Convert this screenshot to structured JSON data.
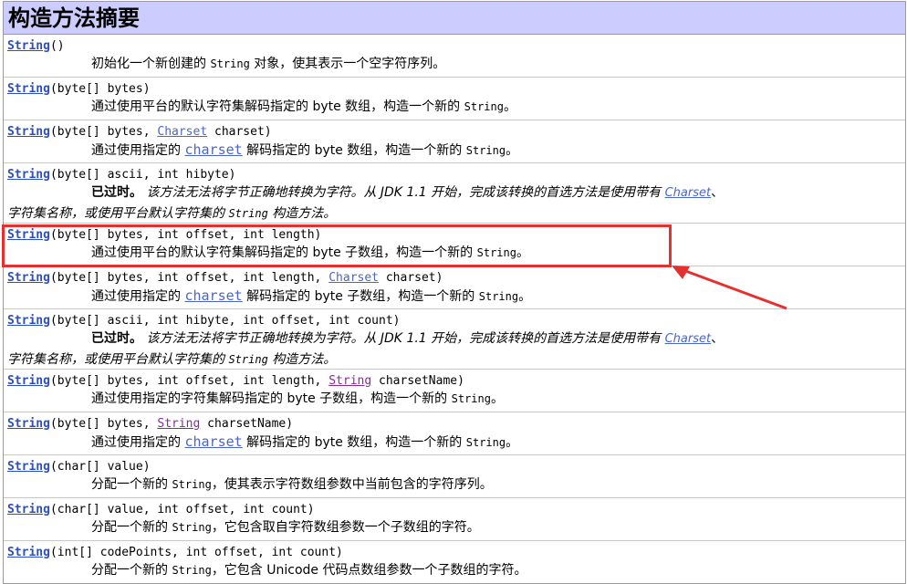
{
  "title": "构造方法摘要",
  "rows": [
    {
      "name": "String",
      "params": "()",
      "desc_pre": "初始化一个新创建的 ",
      "desc_code": "String",
      "desc_post": " 对象，使其表示一个空字符序列。"
    },
    {
      "name": "String",
      "params": "(byte[] bytes)",
      "desc_pre": "通过使用平台的默认字符集解码指定的 byte 数组，构造一个新的 ",
      "desc_code": "String",
      "desc_post": "。"
    },
    {
      "name": "String",
      "p1": "(byte[] bytes, ",
      "type": "Charset",
      "p2": " charset)",
      "d1": "通过使用指定的 ",
      "dl": "charset",
      "d2": " 解码指定的 byte 数组，构造一个新的 ",
      "dc": "String",
      "d3": "。"
    },
    {
      "name": "String",
      "params": "(byte[] ascii, int hibyte)",
      "dep": "已过时。",
      "l1": " 该方法无法将字节正确地转换为字符。从 JDK 1.1 开始，完成该转换的首选方法是使用带有 ",
      "lnk": "Charset",
      "l1b": "、",
      "l2": "字符集名称，或使用平台默认字符集的 ",
      "lc": "String",
      "l2b": " 构造方法。"
    },
    {
      "name": "String",
      "params": "(byte[] bytes, int offset, int length)",
      "desc_pre": "通过使用平台的默认字符集解码指定的 byte 子数组，构造一个新的 ",
      "desc_code": "String",
      "desc_post": "。"
    },
    {
      "name": "String",
      "p1": "(byte[] bytes, int offset, int length, ",
      "type": "Charset",
      "p2": " charset)",
      "d1": "通过使用指定的 ",
      "dl": "charset",
      "d2": " 解码指定的 byte 子数组，构造一个新的 ",
      "dc": "String",
      "d3": "。"
    },
    {
      "name": "String",
      "params": "(byte[] ascii, int hibyte, int offset, int count)",
      "dep": "已过时。",
      "l1": " 该方法无法将字节正确地转换为字符。从 JDK 1.1 开始，完成该转换的首选方法是使用带有 ",
      "lnk": "Charset",
      "l1b": "、",
      "l2": "字符集名称，或使用平台默认字符集的 ",
      "lc": "String",
      "l2b": " 构造方法。"
    },
    {
      "name": "String",
      "p1": "(byte[] bytes, int offset, int length, ",
      "type": "String",
      "p2": " charsetName)",
      "desc_pre": "通过使用指定的字符集解码指定的 byte 子数组，构造一个新的 ",
      "desc_code": "String",
      "desc_post": "。"
    },
    {
      "name": "String",
      "p1": "(byte[] bytes, ",
      "type": "String",
      "p2": " charsetName)",
      "d1": "通过使用指定的 ",
      "dl": "charset",
      "d2": " 解码指定的 byte 数组，构造一个新的 ",
      "dc": "String",
      "d3": "。"
    },
    {
      "name": "String",
      "params": "(char[] value)",
      "desc_pre": "分配一个新的 ",
      "desc_code": "String",
      "desc_post": "，使其表示字符数组参数中当前包含的字符序列。"
    },
    {
      "name": "String",
      "params": "(char[] value, int offset, int count)",
      "desc_pre": "分配一个新的 ",
      "desc_code": "String",
      "desc_post": "，它包含取自字符数组参数一个子数组的字符。"
    },
    {
      "name": "String",
      "params": "(int[] codePoints, int offset, int count)",
      "desc_pre": "分配一个新的 ",
      "desc_code": "String",
      "desc_post": "，它包含 Unicode 代码点数组参数一个子数组的字符。"
    }
  ],
  "colors": {
    "header_bg": "#ccccff",
    "link": "#2c4fbf",
    "highlight": "#e53030"
  }
}
